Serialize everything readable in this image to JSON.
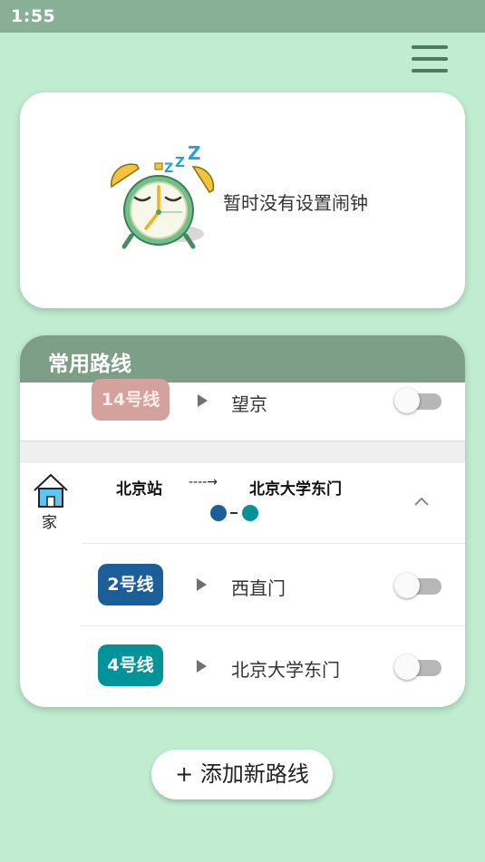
{
  "status_bar": {
    "time": "1:55"
  },
  "alarm": {
    "empty_text": "暂时没有设置闹钟",
    "sleep_text": "Z Z"
  },
  "routes": {
    "title": "常用路线",
    "first_route": {
      "line": {
        "label": "14号线",
        "color": "#d4a19c"
      },
      "station": "望京"
    },
    "home_route": {
      "tag": "家",
      "from": "北京站",
      "to": "北京大学东门",
      "arrow": "----→",
      "dot_colors": [
        "#1c5e9a",
        "#00939a"
      ],
      "segments": [
        {
          "line": "2号线",
          "color": "#1c5e9a",
          "station": "西直门"
        },
        {
          "line": "4号线",
          "color": "#00939a",
          "station": "北京大学东门"
        }
      ]
    }
  },
  "add_route_button": "+ 添加新路线"
}
